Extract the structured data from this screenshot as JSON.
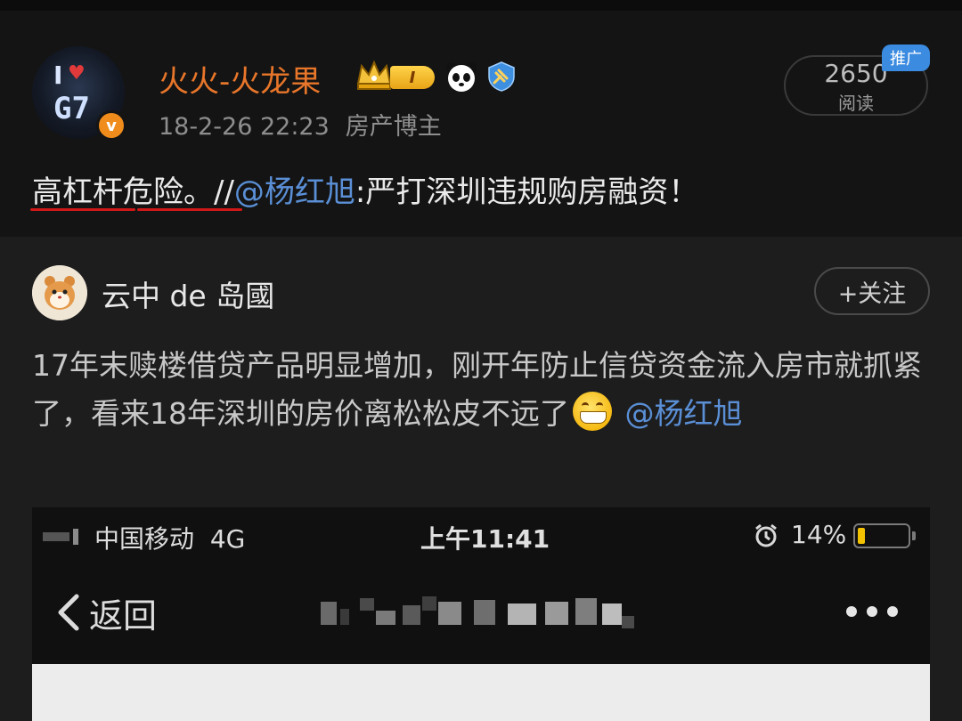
{
  "post": {
    "username": "火火-火龙果",
    "level_badge": "I",
    "timestamp": "18-2-26 22:23",
    "role": "房产博主",
    "verified_icon": "v-badge-icon",
    "reads": {
      "count": "2650",
      "label": "阅读",
      "promo_tag": "推广"
    },
    "text": {
      "main": "高杠杆危险。//",
      "mention": "@杨红旭",
      "rest": ":严打深圳违规购房融资！"
    }
  },
  "repost": {
    "username": "云中 de 岛國",
    "follow_label": "+关注",
    "text": {
      "line1": "17年末赎楼借贷产品明显增加，刚开年防止信贷资金流入房市就抓紧了，看来18年深圳的房价离松松皮不远了",
      "mention": "@杨红旭",
      "emoji": "grinning-face"
    }
  },
  "screenshot": {
    "carrier": "中国移动",
    "network": "4G",
    "time": "上午11:41",
    "battery_pct": "14%",
    "battery_level": 0.14,
    "back_label": "返回"
  },
  "colors": {
    "background": "#141414",
    "card": "#1d1d1d",
    "username": "#e8762a",
    "mention": "#5a8fd6",
    "promo": "#3b8be0",
    "underline": "#d01818"
  }
}
